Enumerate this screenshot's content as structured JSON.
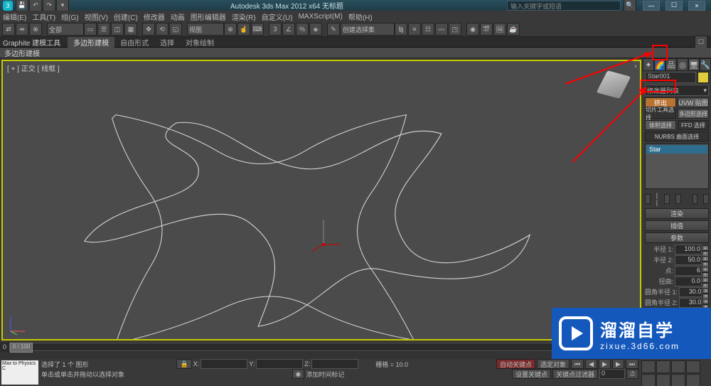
{
  "title": "Autodesk 3ds Max  2012 x64   无标题",
  "title_search_placeholder": "输入关键字或短语",
  "window_buttons": {
    "min": "—",
    "max": "☐",
    "close": "×"
  },
  "menu": [
    "编辑(E)",
    "工具(T)",
    "组(G)",
    "视图(V)",
    "创建(C)",
    "修改器",
    "动画",
    "图形编辑器",
    "渲染(R)",
    "自定义(U)",
    "MAXScript(M)",
    "帮助(H)"
  ],
  "toolbar": {
    "dd_all": "全部",
    "dd_view": "视图",
    "dd_create": "创建选择集"
  },
  "ribbon": {
    "label": "Graphite 建模工具",
    "tabs": [
      "多边形建模",
      "自由形式",
      "选择",
      "对象绘制"
    ],
    "sub": "多边形建模"
  },
  "viewport": {
    "label": "[ + ] 正交 [ 线框 ]"
  },
  "cmd": {
    "obj_name": "Star001",
    "modlist": "修改器列表",
    "btn_extrude": "挤出",
    "btn_uvw": "UVW 贴图",
    "btn_slice": "切片工具选择",
    "btn_poly": "多边形选择",
    "btn_vol": "体积选择",
    "btn_ffd": "FFD 选择",
    "btn_curve": "NURBS 曲面选择",
    "stack_item": "Star",
    "roll_render": "渲染",
    "roll_interp": "插值",
    "roll_params": "参数",
    "p_radius1": "半径 1:",
    "v_radius1": "100.0",
    "p_radius2": "半径 2:",
    "v_radius2": "50.0",
    "p_points": "点:",
    "v_points": "6",
    "p_twist": "扭曲:",
    "v_twist": "0.0",
    "p_fillet1": "圆角半径 1:",
    "v_fillet1": "30.0",
    "p_fillet2": "圆角半径 2:",
    "v_fillet2": "30.0"
  },
  "time": {
    "frame": "0 / 100",
    "start": "0"
  },
  "status": {
    "selinfo": "选择了 1 个 图形",
    "hint": "单击或单击并拖动以选择对象",
    "xyz_x": "X:",
    "xyz_y": "Y:",
    "xyz_z": "Z:",
    "grid": "栅格 = 10.0",
    "add_time": "添加时间标记",
    "autokey": "自动关键点",
    "setkey": "设置关键点",
    "selected": "选定对象",
    "keyfilter": "关键点过滤器"
  },
  "maxscript": "Max to Physics C",
  "watermark": {
    "big": "溜溜自学",
    "small": "zixue.3d66.com"
  }
}
